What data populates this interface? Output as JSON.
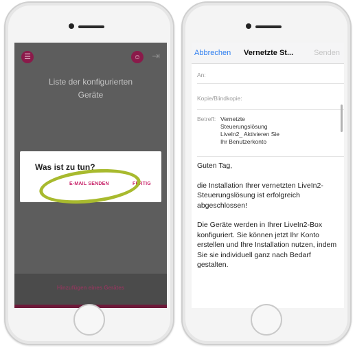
{
  "left_app": {
    "menu_icon": "hamburger-icon",
    "user_icon": "user-icon",
    "logout_icon": "logout-icon",
    "list_title": "Liste der konfigurierten Geräte",
    "add_device": "Hinzufügen eines Gerätes",
    "dialog": {
      "title": "Was ist zu tun?",
      "send_email": "E-MAIL SENDEN",
      "done": "FERTIG"
    },
    "colors": {
      "accent": "#c8246a",
      "highlight_ring": "#a8ba2e",
      "overlay": "#5d5d5d"
    }
  },
  "mail": {
    "cancel": "Abbrechen",
    "title": "Vernetzte St...",
    "send": "Senden",
    "to_label": "An:",
    "cc_label": "Kopie/Blindkopie:",
    "subject_label": "Betreff:",
    "subject": "Vernetzte Steuerungslösung LiveIn2_ Aktivieren Sie Ihr Benutzerkonto",
    "greeting": "Guten Tag,",
    "para1": "die Installation Ihrer vernetzten LiveIn2-Steuerungslösung ist erfolgreich abgeschlossen!",
    "para2": "Die Geräte werden in Ihrer LiveIn2-Box konfiguriert. Sie können jetzt Ihr Konto erstellen und Ihre Installation nutzen, indem Sie sie individuell ganz nach Bedarf gestalten.",
    "colors": {
      "link": "#2f7ff0"
    }
  }
}
